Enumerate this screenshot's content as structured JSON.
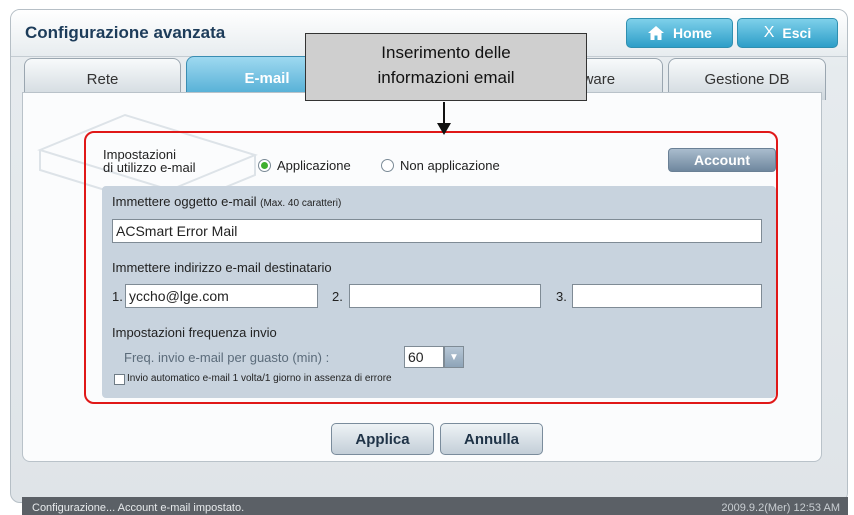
{
  "window": {
    "title": "Configurazione avanzata",
    "home_label": "Home",
    "exit_label": "Esci"
  },
  "tabs": [
    {
      "label": "Rete",
      "active": false
    },
    {
      "label": "E-mail",
      "active": true
    },
    {
      "label": "",
      "active": false
    },
    {
      "label": "Software",
      "active": false
    },
    {
      "label": "Gestione DB",
      "active": false
    }
  ],
  "callout": {
    "line1": "Inserimento delle",
    "line2": "informazioni email"
  },
  "usage": {
    "label_line1": "Impostazioni",
    "label_line2": "di utilizzo e-mail",
    "option_apply": "Applicazione",
    "option_not_apply": "Non applicazione",
    "selected": "Applicazione",
    "account_button": "Account"
  },
  "subject": {
    "label": "Immettere oggetto e-mail",
    "hint": "(Max. 40 caratteri)",
    "value": "ACSmart Error Mail"
  },
  "recipients": {
    "label": "Immettere indirizzo e-mail destinatario",
    "items": [
      {
        "num": "1.",
        "value": "yccho@lge.com"
      },
      {
        "num": "2.",
        "value": ""
      },
      {
        "num": "3.",
        "value": ""
      }
    ]
  },
  "frequency": {
    "section_label": "Impostazioni frequenza invio",
    "fault_label": "Freq. invio e-mail per guasto (min) :",
    "fault_value": "60",
    "auto_label": "Invio automatico e-mail 1 volta/1 giorno in assenza di errore",
    "auto_checked": false
  },
  "actions": {
    "apply": "Applica",
    "cancel": "Annulla"
  },
  "status": {
    "message": "Configurazione... Account e-mail impostato.",
    "datetime": "2009.9.2(Mer)  12:53 AM"
  },
  "colors": {
    "accent_blue": "#2d9ec8",
    "highlight_red": "#e01818",
    "panel": "#c8d3de"
  }
}
